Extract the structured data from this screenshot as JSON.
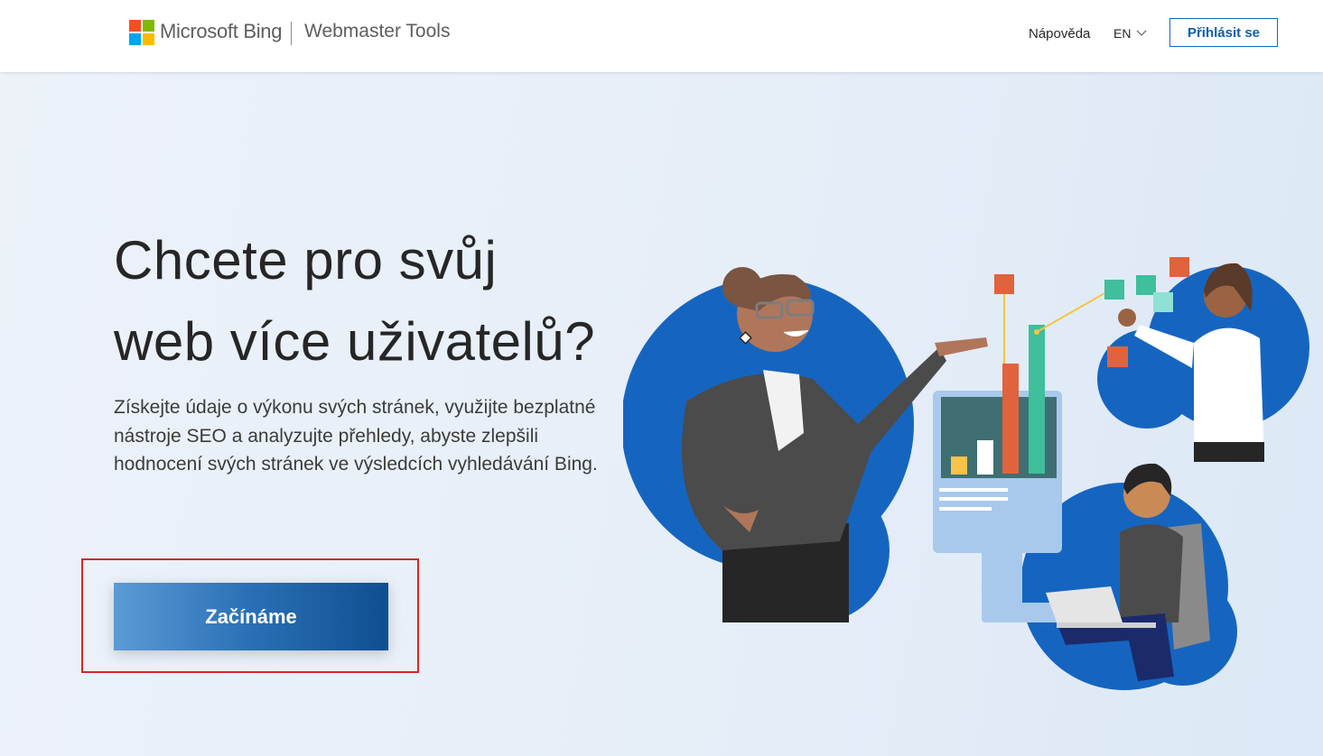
{
  "header": {
    "brand": "Microsoft Bing",
    "product": "Webmaster Tools",
    "help_label": "Nápověda",
    "language": "EN",
    "signin_label": "Přihlásit se"
  },
  "hero": {
    "title_line1": "Chcete pro svůj",
    "title_line2": "web více uživatelů?",
    "description": "Získejte údaje o výkonu svých stránek, využijte bezplatné nástroje SEO a analyzujte přehledy, abyste zlepšili hodnocení svých stránek ve výsledcích vyhledávání Bing.",
    "cta_label": "Začínáme"
  },
  "colors": {
    "accent": "#0f6cbd",
    "cta_gradient_start": "#5b9bd5",
    "cta_gradient_end": "#0f4f91",
    "highlight_border": "#d7262c",
    "ms_red": "#f25022",
    "ms_green": "#7fba00",
    "ms_blue": "#00a4ef",
    "ms_yellow": "#ffb900"
  },
  "icons": {
    "logo": "microsoft-logo-icon",
    "language_chevron": "chevron-down-icon"
  }
}
